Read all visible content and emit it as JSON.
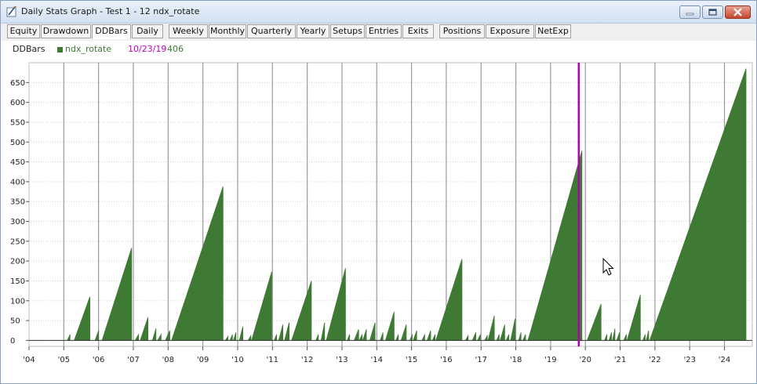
{
  "window": {
    "title": "Daily Stats Graph - Test 1 - 12 ndx_rotate",
    "icon": "graph-pencil-icon",
    "controls": [
      "minimize-icon",
      "maximize-icon",
      "close-icon"
    ]
  },
  "tabs": [
    {
      "label": "Equity",
      "active": false
    },
    {
      "label": "Drawdown",
      "active": false
    },
    {
      "label": "DDBars",
      "active": true
    },
    {
      "label": "Daily",
      "active": false
    },
    {
      "label": "Weekly",
      "active": false
    },
    {
      "label": "Monthly",
      "active": false
    },
    {
      "label": "Quarterly",
      "active": false
    },
    {
      "label": "Yearly",
      "active": false
    },
    {
      "label": "Setups",
      "active": false
    },
    {
      "label": "Entries",
      "active": false
    },
    {
      "label": "Exits",
      "active": false
    },
    {
      "label": "Positions",
      "active": false
    },
    {
      "label": "Exposure",
      "active": false
    },
    {
      "label": "NetExp",
      "active": false
    }
  ],
  "legend": {
    "title": "DDBars",
    "series_name": "ndx_rotate",
    "cursor_date": "10/23/19",
    "cursor_value": "406"
  },
  "colors": {
    "series": "#3f7a34",
    "cursor": "#b000b0",
    "gridline": "#9a9a9a"
  },
  "chart_data": {
    "type": "area",
    "title": "",
    "xlabel": "",
    "ylabel": "",
    "ylim": [
      -15,
      700
    ],
    "xlim": [
      2004.0,
      2024.8
    ],
    "yticks": [
      0,
      50,
      100,
      150,
      200,
      250,
      300,
      350,
      400,
      450,
      500,
      550,
      600,
      650
    ],
    "xticks": [
      "'04",
      "'05",
      "'06",
      "'07",
      "'08",
      "'09",
      "'10",
      "'11",
      "'12",
      "'13",
      "'14",
      "'15",
      "'16",
      "'17",
      "'18",
      "'19",
      "'20",
      "'21",
      "'22",
      "'23",
      "'24"
    ],
    "xtick_values": [
      2004,
      2005,
      2006,
      2007,
      2008,
      2009,
      2010,
      2011,
      2012,
      2013,
      2014,
      2015,
      2016,
      2017,
      2018,
      2019,
      2020,
      2021,
      2022,
      2023,
      2024
    ],
    "grid": {
      "vertical": true,
      "horizontal_dotted": true
    },
    "cursor_x": 2019.81,
    "series": [
      {
        "name": "ndx_rotate",
        "peaks": [
          [
            2005.1,
            2005.18,
            15
          ],
          [
            2005.3,
            2005.75,
            110
          ],
          [
            2005.9,
            2006.0,
            25
          ],
          [
            2006.1,
            2006.95,
            233
          ],
          [
            2007.05,
            2007.15,
            15
          ],
          [
            2007.2,
            2007.42,
            58
          ],
          [
            2007.55,
            2007.65,
            30
          ],
          [
            2007.7,
            2007.8,
            15
          ],
          [
            2007.92,
            2008.05,
            25
          ],
          [
            2008.1,
            2009.58,
            388
          ],
          [
            2009.65,
            2009.72,
            10
          ],
          [
            2009.78,
            2009.85,
            15
          ],
          [
            2009.88,
            2009.95,
            20
          ],
          [
            2010.05,
            2010.15,
            35
          ],
          [
            2010.3,
            2010.38,
            12
          ],
          [
            2010.4,
            2010.98,
            173
          ],
          [
            2011.05,
            2011.12,
            15
          ],
          [
            2011.18,
            2011.3,
            40
          ],
          [
            2011.35,
            2011.48,
            45
          ],
          [
            2011.55,
            2012.12,
            150
          ],
          [
            2012.25,
            2012.32,
            15
          ],
          [
            2012.4,
            2012.5,
            45
          ],
          [
            2012.55,
            2013.1,
            182
          ],
          [
            2013.15,
            2013.22,
            15
          ],
          [
            2013.35,
            2013.48,
            28
          ],
          [
            2013.5,
            2013.58,
            15
          ],
          [
            2013.6,
            2013.7,
            28
          ],
          [
            2013.8,
            2013.95,
            45
          ],
          [
            2014.1,
            2014.18,
            20
          ],
          [
            2014.25,
            2014.5,
            72
          ],
          [
            2014.55,
            2014.62,
            15
          ],
          [
            2014.7,
            2014.85,
            40
          ],
          [
            2014.95,
            2015.02,
            15
          ],
          [
            2015.05,
            2015.15,
            25
          ],
          [
            2015.3,
            2015.38,
            15
          ],
          [
            2015.45,
            2015.55,
            25
          ],
          [
            2015.6,
            2015.68,
            15
          ],
          [
            2015.7,
            2016.45,
            205
          ],
          [
            2016.55,
            2016.63,
            12
          ],
          [
            2016.75,
            2016.85,
            20
          ],
          [
            2016.9,
            2016.98,
            15
          ],
          [
            2017.1,
            2017.18,
            12
          ],
          [
            2017.2,
            2017.38,
            62
          ],
          [
            2017.45,
            2017.52,
            15
          ],
          [
            2017.55,
            2017.68,
            40
          ],
          [
            2017.72,
            2017.8,
            15
          ],
          [
            2017.85,
            2017.98,
            55
          ],
          [
            2018.08,
            2018.15,
            20
          ],
          [
            2018.2,
            2018.28,
            15
          ],
          [
            2018.35,
            2019.9,
            478
          ],
          [
            2020.05,
            2020.45,
            92
          ],
          [
            2020.55,
            2020.62,
            15
          ],
          [
            2020.68,
            2020.75,
            20
          ],
          [
            2020.78,
            2020.85,
            30
          ],
          [
            2020.9,
            2020.98,
            20
          ],
          [
            2021.1,
            2021.18,
            15
          ],
          [
            2021.2,
            2021.58,
            115
          ],
          [
            2021.65,
            2021.72,
            15
          ],
          [
            2021.75,
            2021.82,
            25
          ],
          [
            2021.85,
            2024.62,
            685
          ]
        ]
      }
    ]
  }
}
